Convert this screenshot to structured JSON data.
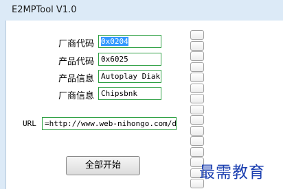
{
  "window": {
    "title": "E2MPTool V1.0"
  },
  "form": {
    "vendor_code": {
      "label": "厂商代码",
      "value": "0x0204"
    },
    "product_code": {
      "label": "产品代码",
      "value": "0x6025"
    },
    "product_info": {
      "label": "产品信息",
      "value": "Autoplay Diak"
    },
    "vendor_info": {
      "label": "厂商信息",
      "value": "Chipsbnk"
    },
    "url": {
      "label": "URL",
      "value": "=http://www.web-nihongo.com/di"
    }
  },
  "actions": {
    "start_all_label": "全部开始"
  },
  "watermark": {
    "text": "最需教育"
  }
}
